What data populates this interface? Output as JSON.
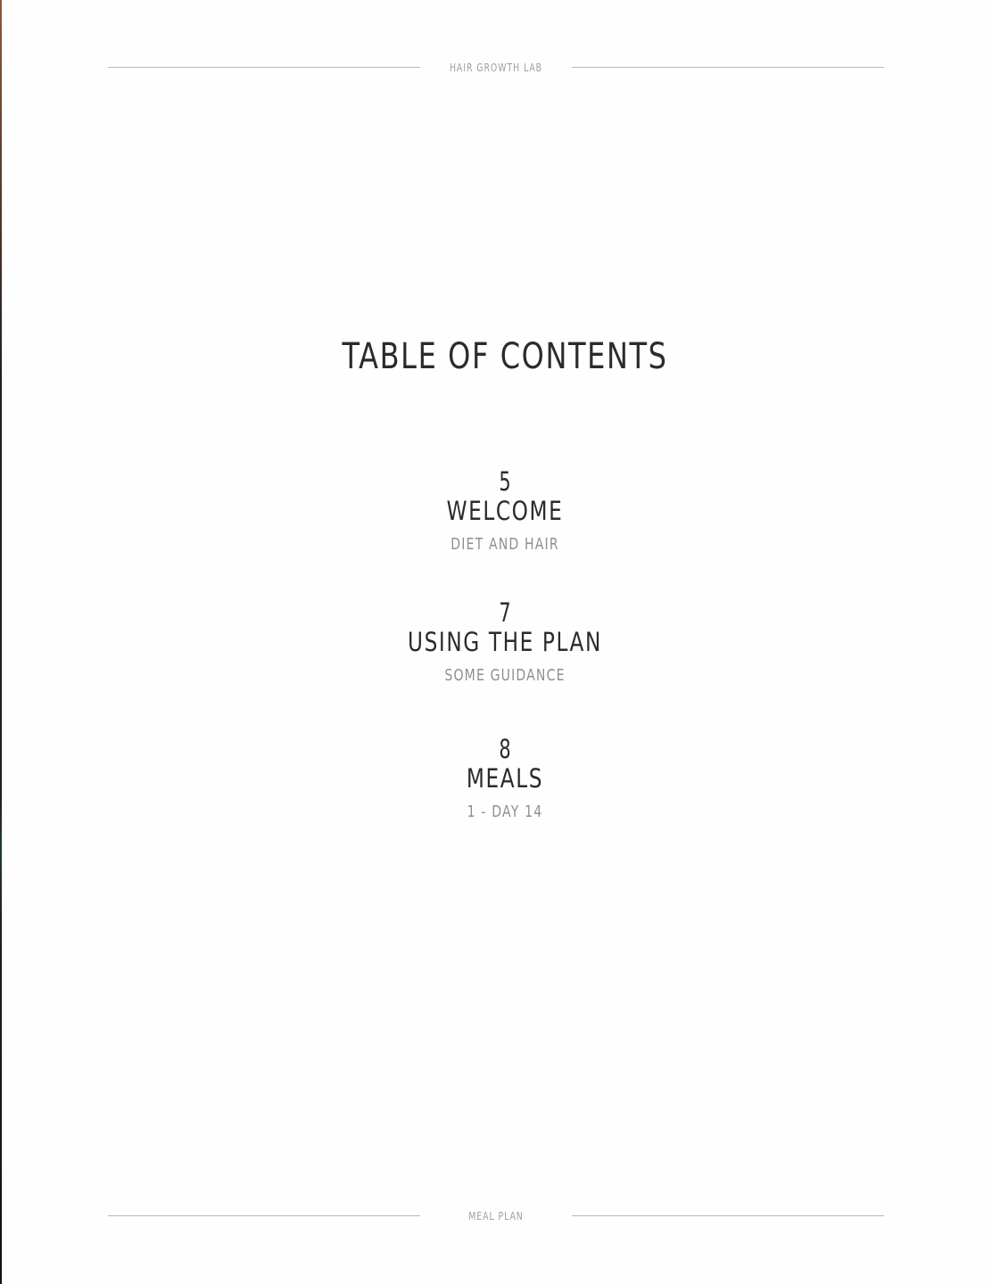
{
  "header": {
    "label": "HAIR GROWTH LAB"
  },
  "footer": {
    "label": "MEAL PLAN"
  },
  "title": "TABLE OF CONTENTS",
  "entries": [
    {
      "page": "5",
      "name": "WELCOME",
      "subtitle": "DIET AND HAIR"
    },
    {
      "page": "7",
      "name": "USING THE PLAN",
      "subtitle": "SOME GUIDANCE"
    },
    {
      "page": "8",
      "name": "MEALS",
      "subtitle": "1 - DAY 14"
    }
  ],
  "colors": {
    "text": "#2b2b2b",
    "subtitle": "#8f8f8f",
    "rule": "#b9b9b9",
    "background": "#fefefe"
  }
}
